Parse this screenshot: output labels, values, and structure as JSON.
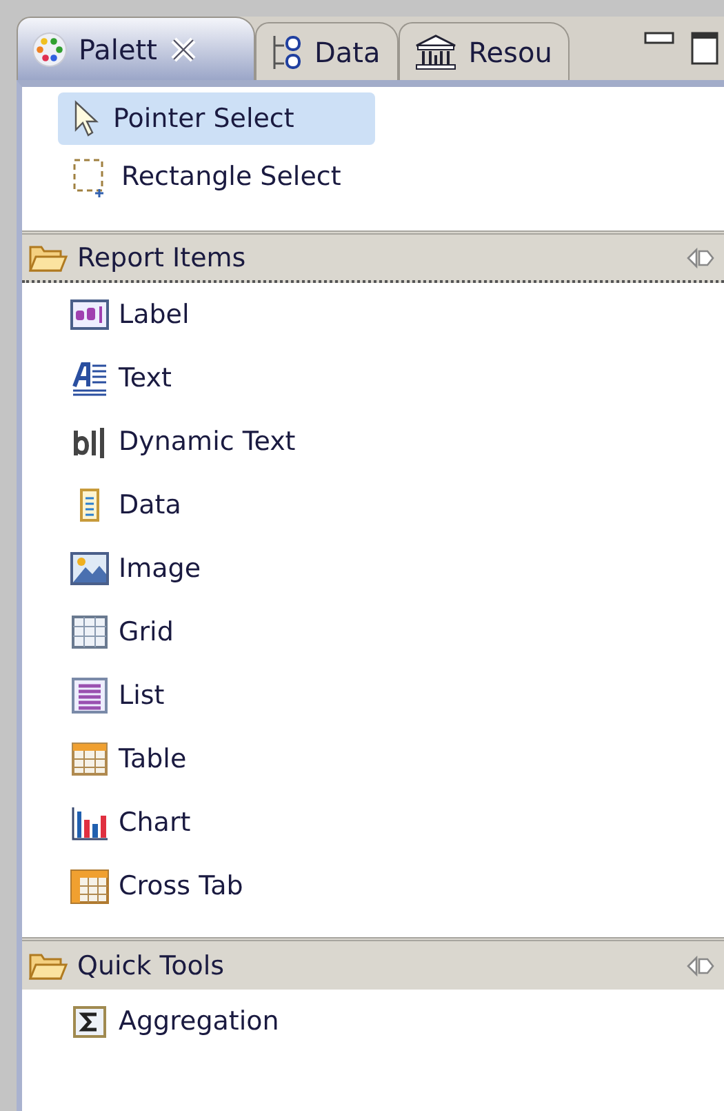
{
  "tabs": [
    {
      "label": "Palett",
      "kind": "palette",
      "selected": true,
      "closable": true
    },
    {
      "label": "Data",
      "kind": "data",
      "selected": false,
      "closable": false
    },
    {
      "label": "Resou",
      "kind": "resource",
      "selected": false,
      "closable": false
    }
  ],
  "tools": [
    {
      "label": "Pointer Select",
      "kind": "pointer",
      "selected": true
    },
    {
      "label": "Rectangle Select",
      "kind": "marquee",
      "selected": false
    }
  ],
  "drawers": [
    {
      "title": "Report Items",
      "expanded": true,
      "items": [
        {
          "label": "Label",
          "kind": "label"
        },
        {
          "label": "Text",
          "kind": "text"
        },
        {
          "label": "Dynamic Text",
          "kind": "dyntext"
        },
        {
          "label": "Data",
          "kind": "data"
        },
        {
          "label": "Image",
          "kind": "image"
        },
        {
          "label": "Grid",
          "kind": "grid"
        },
        {
          "label": "List",
          "kind": "list"
        },
        {
          "label": "Table",
          "kind": "table"
        },
        {
          "label": "Chart",
          "kind": "chart"
        },
        {
          "label": "Cross Tab",
          "kind": "crosstab"
        }
      ]
    },
    {
      "title": "Quick Tools",
      "expanded": true,
      "items": [
        {
          "label": "Aggregation",
          "kind": "sigma"
        }
      ]
    }
  ]
}
